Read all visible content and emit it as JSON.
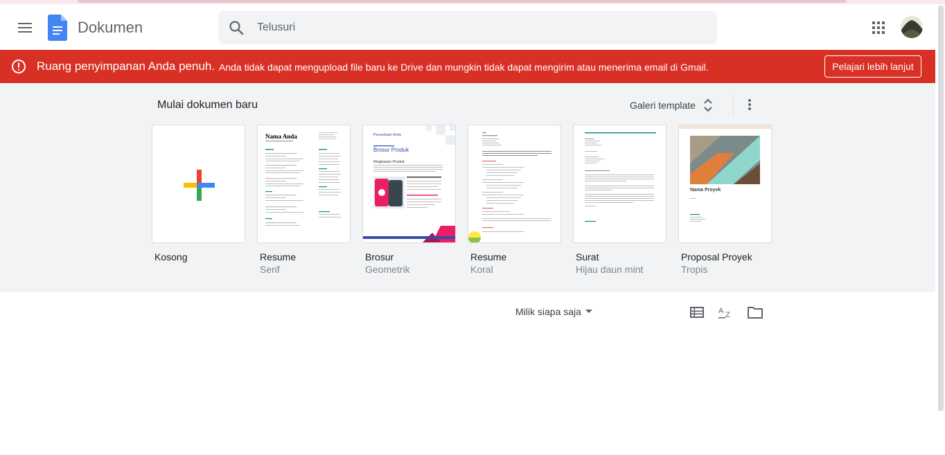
{
  "header": {
    "app_title": "Dokumen",
    "search_placeholder": "Telusuri",
    "icons": [
      "menu-icon",
      "docs-logo-icon",
      "search-icon",
      "apps-grid-icon",
      "avatar"
    ]
  },
  "banner": {
    "title": "Ruang penyimpanan Anda penuh.",
    "message": "Anda tidak dapat mengupload file baru ke Drive dan mungkin tidak dapat mengirim atau menerima email di Gmail.",
    "button_label": "Pelajari lebih lanjut",
    "color": "#d93025"
  },
  "gallery": {
    "heading": "Mulai dokumen baru",
    "template_gallery_label": "Galeri template",
    "templates": [
      {
        "name": "Kosong",
        "sub": ""
      },
      {
        "name": "Resume",
        "sub": "Serif"
      },
      {
        "name": "Brosur",
        "sub": "Geometrik"
      },
      {
        "name": "Resume",
        "sub": "Koral"
      },
      {
        "name": "Surat",
        "sub": "Hijau daun mint"
      },
      {
        "name": "Proposal Proyek",
        "sub": "Tropis"
      }
    ],
    "thumb_text": {
      "resume_serif_name": "Nama Anda",
      "brosur_company": "Perusahaan Anda",
      "brosur_title": "Brosur Produk",
      "brosur_section": "Ringkasan Produk",
      "proposal_title": "Nama Proyek"
    }
  },
  "list_toolbar": {
    "owner_filter": "Milik siapa saja",
    "icons": [
      "list-view-icon",
      "sort-az-icon",
      "folder-icon"
    ]
  }
}
